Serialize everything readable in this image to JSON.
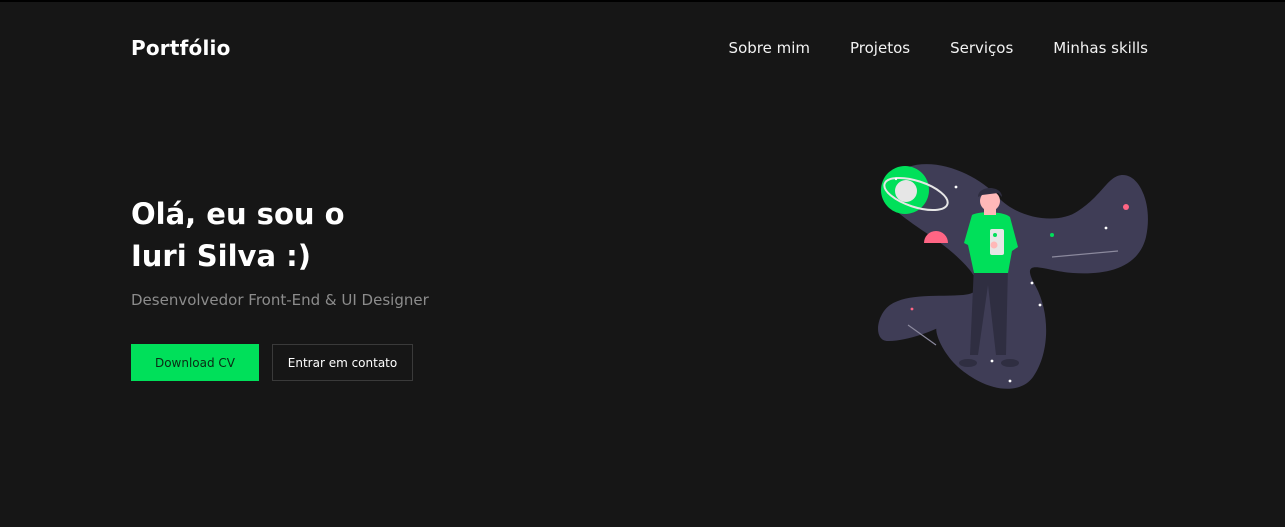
{
  "header": {
    "brand": "Portfólio",
    "nav": [
      {
        "label": "Sobre mim"
      },
      {
        "label": "Projetos"
      },
      {
        "label": "Serviços"
      },
      {
        "label": "Minhas skills"
      }
    ]
  },
  "hero": {
    "title_line1": "Olá, eu sou o",
    "title_line2": "Iuri Silva :)",
    "subtitle": "Desenvolvedor Front-End & UI Designer",
    "primary_button": "Download CV",
    "secondary_button": "Entrar em contato"
  },
  "theme": {
    "background": "#161616",
    "accent": "#00e05a",
    "muted_text": "#8c8c8c",
    "space_color": "#3f3d56",
    "pink": "#ff6584"
  },
  "illustration": {
    "icon": "astronaut-space-illustration"
  }
}
